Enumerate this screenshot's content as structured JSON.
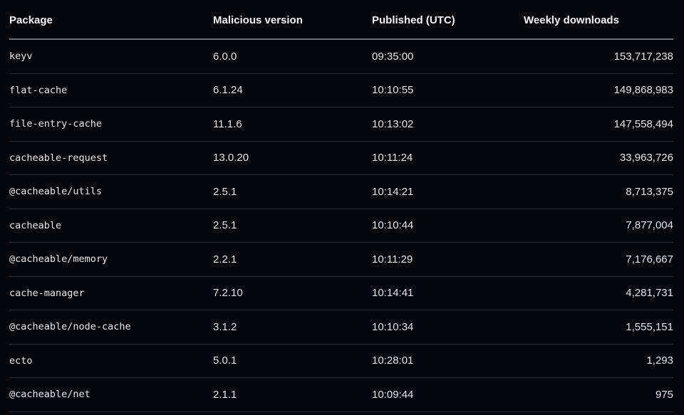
{
  "table": {
    "headers": {
      "package": "Package",
      "version": "Malicious version",
      "published": "Published (UTC)",
      "downloads": "Weekly downloads"
    },
    "rows": [
      {
        "package": "keyv",
        "version": "6.0.0",
        "published": "09:35:00",
        "downloads": "153,717,238"
      },
      {
        "package": "flat-cache",
        "version": "6.1.24",
        "published": "10:10:55",
        "downloads": "149,868,983"
      },
      {
        "package": "file-entry-cache",
        "version": "11.1.6",
        "published": "10:13:02",
        "downloads": "147,558,494"
      },
      {
        "package": "cacheable-request",
        "version": "13.0.20",
        "published": "10:11:24",
        "downloads": "33,963,726"
      },
      {
        "package": "@cacheable/utils",
        "version": "2.5.1",
        "published": "10:14:21",
        "downloads": "8,713,375"
      },
      {
        "package": "cacheable",
        "version": "2.5.1",
        "published": "10:10:44",
        "downloads": "7,877,004"
      },
      {
        "package": "@cacheable/memory",
        "version": "2.2.1",
        "published": "10:11:29",
        "downloads": "7,176,667"
      },
      {
        "package": "cache-manager",
        "version": "7.2.10",
        "published": "10:14:41",
        "downloads": "4,281,731"
      },
      {
        "package": "@cacheable/node-cache",
        "version": "3.1.2",
        "published": "10:10:34",
        "downloads": "1,555,151"
      },
      {
        "package": "ecto",
        "version": "5.0.1",
        "published": "10:28:01",
        "downloads": "1,293"
      },
      {
        "package": "@cacheable/net",
        "version": "2.1.1",
        "published": "10:09:44",
        "downloads": "975"
      }
    ]
  }
}
